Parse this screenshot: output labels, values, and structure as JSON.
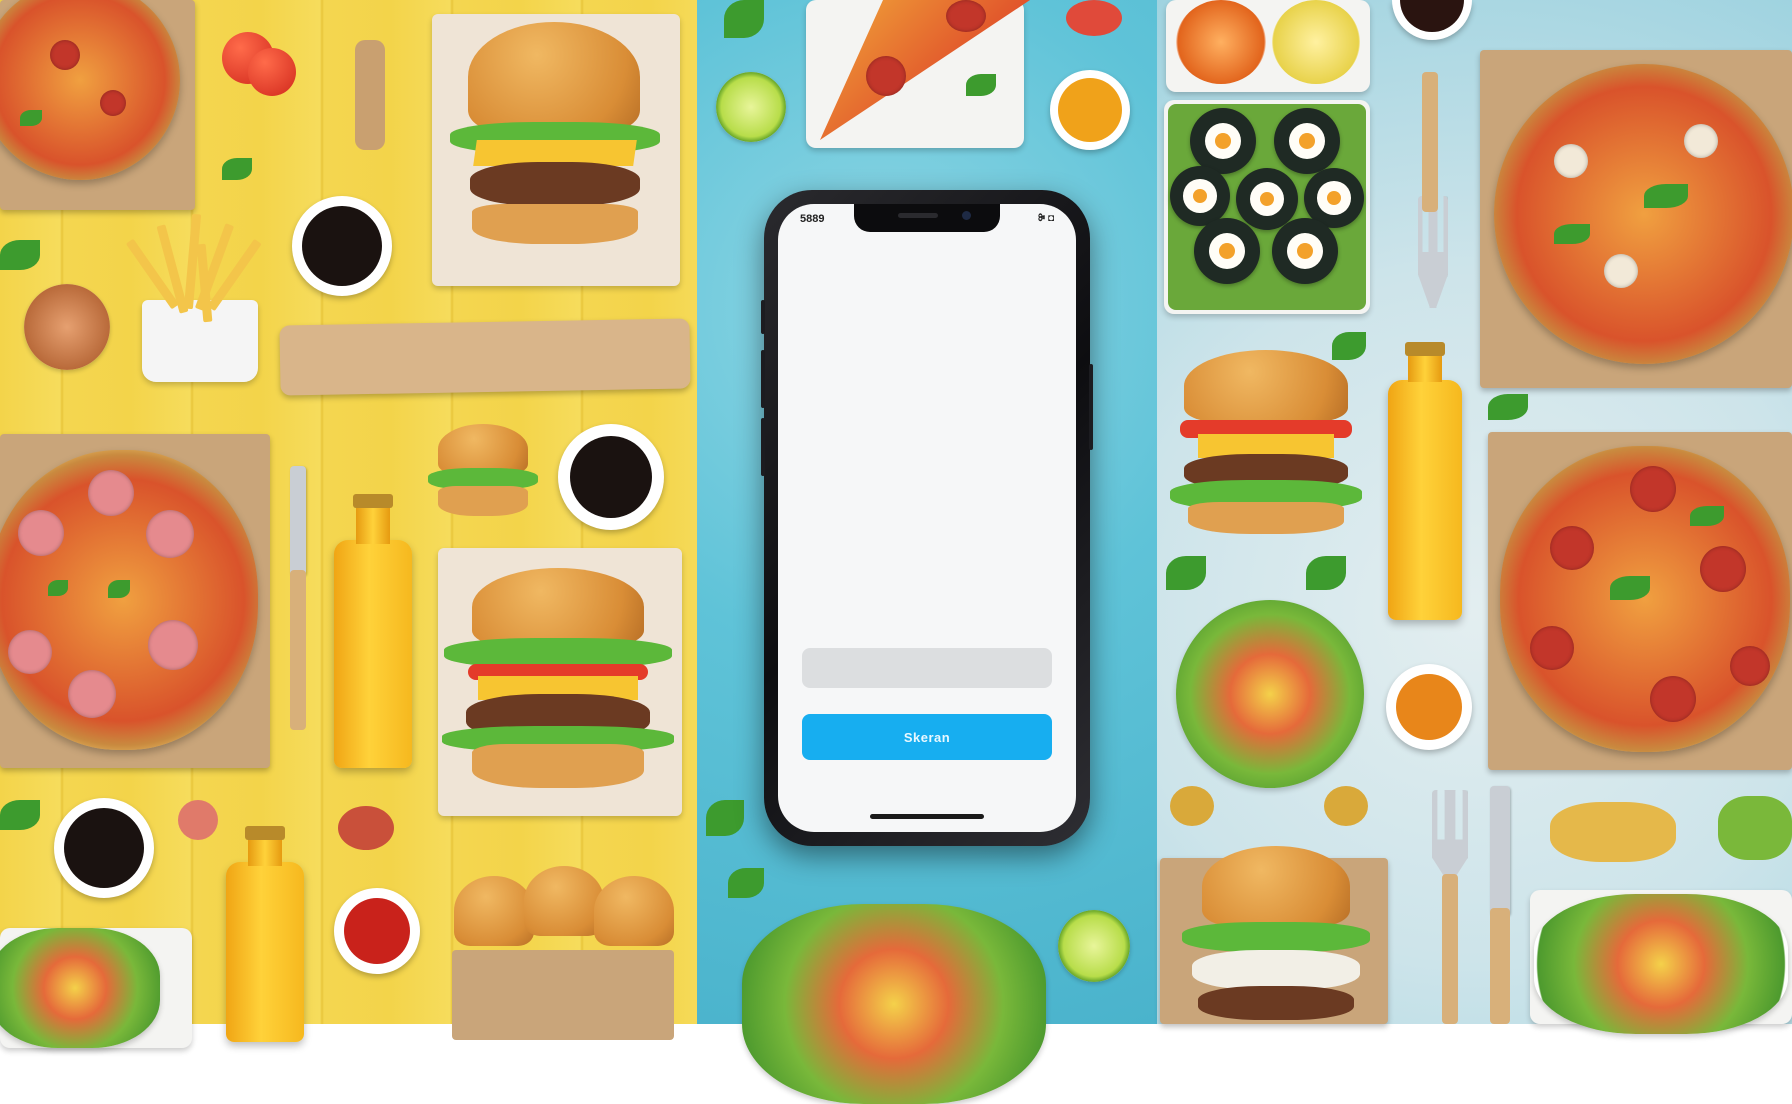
{
  "phone": {
    "status_time": "5889",
    "status_icons": "ꔭ ◘",
    "input_value": "",
    "primary_button_label": "Skeran"
  },
  "colors": {
    "accent": "#17aef0",
    "left_background": "#f3d44a",
    "middle_background": "#5fc3d8",
    "right_background": "#cde4ea"
  },
  "scene": {
    "items": [
      "pizza",
      "burger",
      "fries",
      "sauce-cup",
      "juice-bottle",
      "sushi",
      "salad",
      "fork",
      "knife",
      "tomato",
      "lime",
      "orange-slice"
    ]
  }
}
